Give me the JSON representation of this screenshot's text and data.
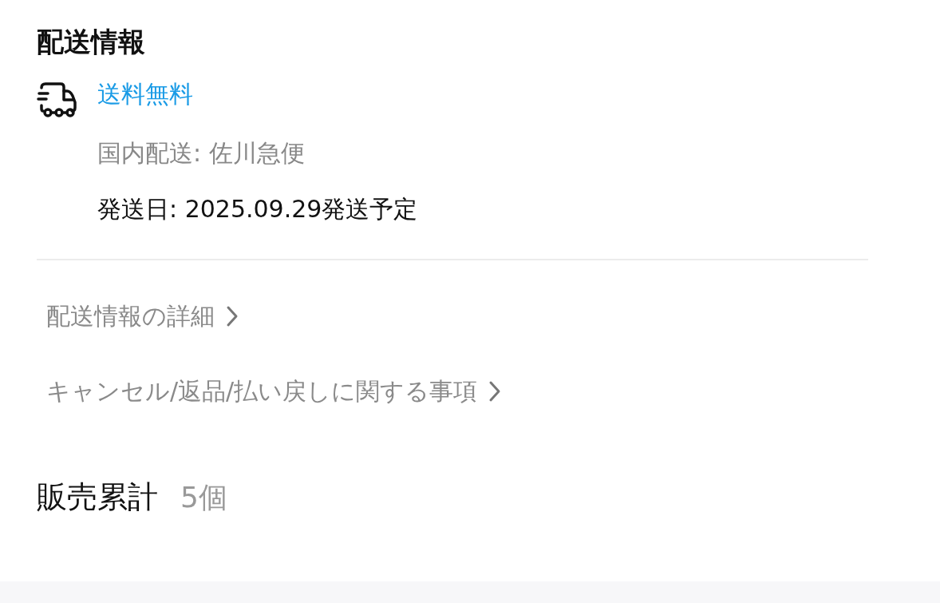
{
  "section_title": "配送情報",
  "shipping": {
    "fee": "送料無料",
    "carrier": "国内配送: 佐川急便",
    "ship_date": "発送日: 2025.09.29発送予定"
  },
  "links": [
    {
      "label": "配送情報の詳細"
    },
    {
      "label": "キャンセル/返品/払い戻しに関する事項"
    }
  ],
  "sales": {
    "label": "販売累計",
    "count": "5個"
  }
}
